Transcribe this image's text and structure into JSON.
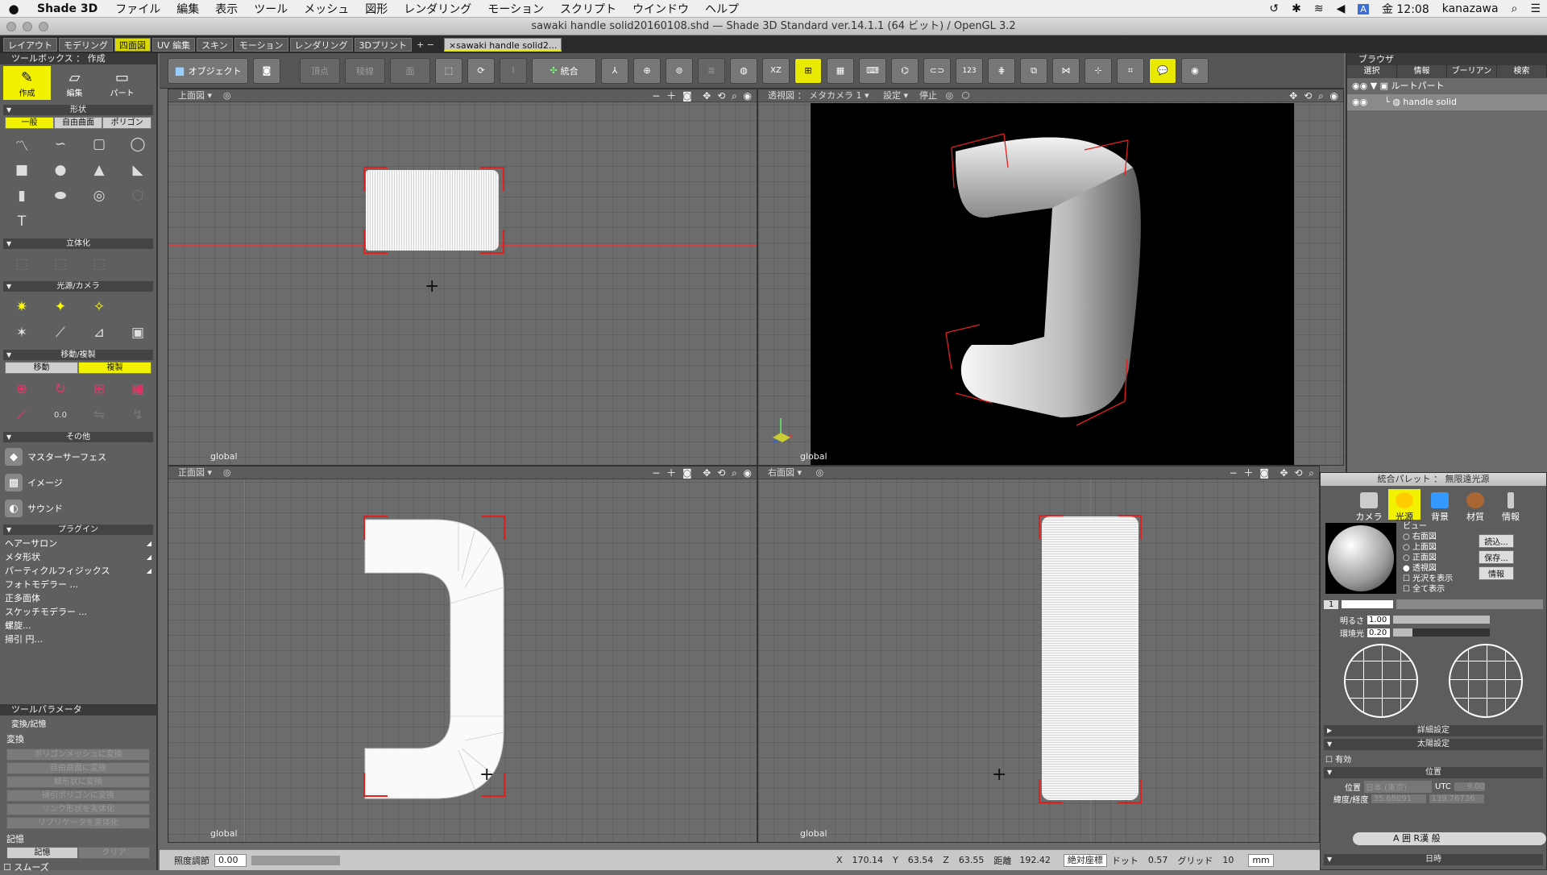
{
  "menubar": {
    "apple": "",
    "app": "Shade 3D",
    "items": [
      "ファイル",
      "編集",
      "表示",
      "ツール",
      "メッシュ",
      "図形",
      "レンダリング",
      "モーション",
      "スクリプト",
      "ウインドウ",
      "ヘルプ"
    ],
    "clock": "金 12:08",
    "user": "kanazawa"
  },
  "window": {
    "title": "sawaki handle solid20160108.shd — Shade 3D Standard ver.14.1.1 (64 ビット) / OpenGL 3.2"
  },
  "tabs": {
    "items": [
      "レイアウト",
      "モデリング",
      "四面図",
      "UV 編集",
      "スキン",
      "モーション",
      "レンダリング",
      "3Dプリント"
    ],
    "selected": "四面図",
    "add": "+ −",
    "doc": "×sawaki handle solid2..."
  },
  "toolbox": {
    "title": "ツールボックス ： 作成",
    "modes": [
      "作成",
      "編集",
      "パート"
    ],
    "shape": "形状",
    "shape_tabs": [
      "一般",
      "自由曲面",
      "ポリゴン"
    ],
    "solid": "立体化",
    "light": "光源/カメラ",
    "move": "移動/複製",
    "move_tabs": [
      "移動",
      "複製"
    ],
    "other": "その他",
    "other_items": [
      "マスターサーフェス",
      "イメージ",
      "サウンド"
    ],
    "plugin": "プラグイン",
    "plugin_items": [
      "ヘアーサロン",
      "メタ形状",
      "パーティクルフィジックス",
      "フォトモデラー ...",
      "正多面体",
      "スケッチモデラー ...",
      "螺旋...",
      "掃引 円..."
    ]
  },
  "toolparams": {
    "title": "ツールパラメータ",
    "sec1": "変換/記憶",
    "sub1": "変換",
    "buttons": [
      "ポリゴンメッシュに変換",
      "自由曲面に変換",
      "線形状に変換",
      "掃引ポリゴンに変換",
      "リンク形状を実体化",
      "リプリケータを実体化"
    ],
    "sub2": "記憶",
    "mem": [
      "記憶",
      "クリア"
    ],
    "smooth": "スムーズ"
  },
  "toolbar": {
    "object": "オブジェクト",
    "vertex": "頂点",
    "edge": "稜線",
    "face": "面",
    "merge": "統合"
  },
  "viewports": {
    "top": {
      "label": "上面図",
      "global": "global"
    },
    "persp": {
      "label": "透視図 ： メタカメラ 1",
      "settings": "設定",
      "stop": "停止",
      "global": "global"
    },
    "front": {
      "label": "正面図",
      "global": "global"
    },
    "right": {
      "label": "右面図",
      "global": "global"
    }
  },
  "browser": {
    "title": "ブラウザ",
    "tabs": [
      "選択",
      "情報",
      "ブーリアン",
      "検索"
    ],
    "tree": [
      "ルートパート",
      "handle solid"
    ]
  },
  "palette": {
    "title": "統合パレット ： 無限遠光源",
    "tabs": [
      "カメラ",
      "光源",
      "背景",
      "材質",
      "情報"
    ],
    "view": "ビュー",
    "radios": [
      "右面図",
      "上面図",
      "正面図",
      "透視図"
    ],
    "checks": [
      "光沢を表示",
      "全て表示"
    ],
    "buttons": [
      "読込...",
      "保存...",
      "情報"
    ],
    "index": "1",
    "brightness_label": "明るさ",
    "brightness": "1.00",
    "ambient_label": "環境光",
    "ambient": "0.20",
    "detail": "詳細設定",
    "sun": "太陽設定",
    "enabled": "有効",
    "pos": "位置",
    "pos_label": "位置",
    "pos_value": "日本 (東京)",
    "utc": "UTC",
    "utc_value": "9.00",
    "latlon_label": "緯度/経度",
    "lat": "35.68091",
    "lon": "139.76736",
    "date": "日時",
    "ime": "A 囲 R漢 般"
  },
  "status": {
    "label": "照度調節",
    "value": "0.00",
    "x_l": "X",
    "x": "170.14",
    "y_l": "Y",
    "y": "63.54",
    "z_l": "Z",
    "z": "63.55",
    "dist_l": "距離",
    "dist": "192.42",
    "coord": "絶対座標",
    "dot_l": "ドット",
    "dot": "0.57",
    "grid_l": "グリッド",
    "grid": "10",
    "unit": "mm"
  }
}
